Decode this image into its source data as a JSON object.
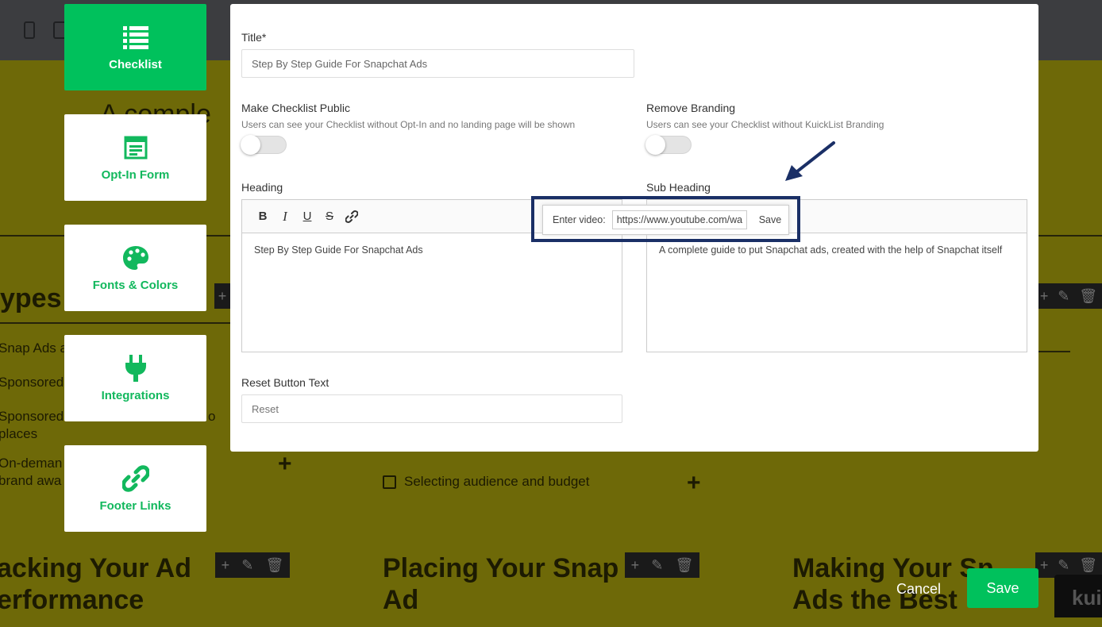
{
  "background": {
    "fragments": {
      "main_heading": "A comple",
      "section_heading": "ypes o",
      "left_items": [
        "Snap Ads a",
        "Sponsored",
        "Sponsored",
        "places",
        "On-deman",
        "brand awa",
        "o"
      ],
      "middle_items": [
        "Selecting audience and budget"
      ],
      "bottom_headings": {
        "left_line1": "acking Your Ad",
        "left_line2": "erformance",
        "middle_line1": "Placing Your Snap",
        "middle_line2": "Ad",
        "right_line1": "Making Your Sn",
        "right_line2": "Ads the Best"
      },
      "logo_text": "kui"
    }
  },
  "nav": {
    "items": [
      {
        "label": "Checklist",
        "icon": "list-icon",
        "active": true
      },
      {
        "label": "Opt-In Form",
        "icon": "form-icon",
        "active": false
      },
      {
        "label": "Fonts & Colors",
        "icon": "palette-icon",
        "active": false
      },
      {
        "label": "Integrations",
        "icon": "plug-icon",
        "active": false
      },
      {
        "label": "Footer Links",
        "icon": "link-icon",
        "active": false
      }
    ]
  },
  "modal": {
    "title_label": "Title*",
    "title_value": "Step By Step Guide For Snapchat Ads",
    "public_label": "Make Checklist Public",
    "public_help": "Users can see your Checklist without Opt-In and no landing page will be shown",
    "public_on": false,
    "branding_label": "Remove Branding",
    "branding_help": "Users can see your Checklist without KuickList Branding",
    "branding_on": false,
    "heading_label": "Heading",
    "heading_text": "Step By Step Guide For Snapchat Ads",
    "subheading_label": "Sub Heading",
    "subheading_text": "A complete guide to put Snapchat ads, created with the help of Snapchat itself",
    "toolbar": {
      "bold": "B",
      "italic": "I",
      "underline": "U",
      "strike": "S"
    },
    "video_popup": {
      "label": "Enter video:",
      "value": "https://www.youtube.com/watch",
      "save": "Save"
    },
    "reset_label": "Reset Button Text",
    "reset_placeholder": "Reset"
  },
  "footer": {
    "cancel": "Cancel",
    "save": "Save"
  },
  "colors": {
    "accent": "#00c15c",
    "annotation": "#1a2f66",
    "overlay": "#6e6908"
  }
}
